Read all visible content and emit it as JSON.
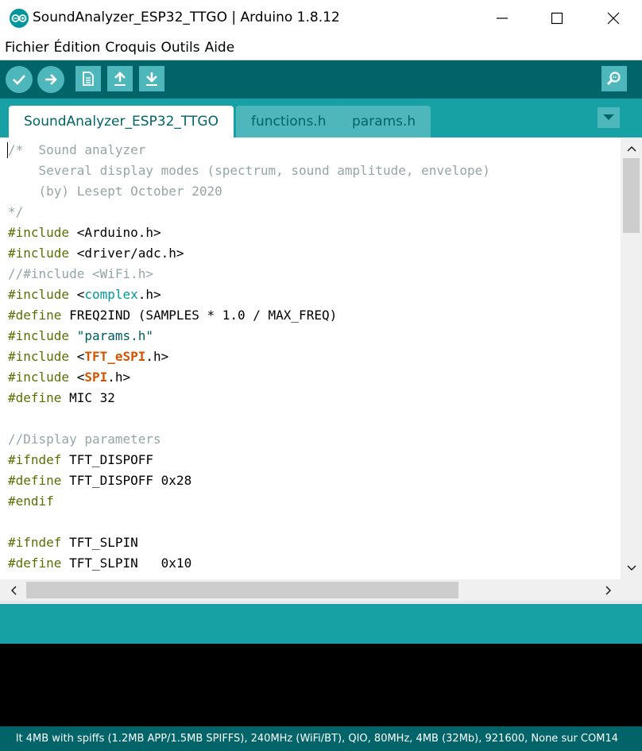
{
  "window": {
    "title": "SoundAnalyzer_ESP32_TTGO | Arduino 1.8.12",
    "logo_icon": "arduino-logo-icon",
    "controls": [
      "minimize-icon",
      "maximize-icon",
      "close-icon"
    ]
  },
  "menu": [
    {
      "label": "Fichier"
    },
    {
      "label": "Édition"
    },
    {
      "label": "Croquis"
    },
    {
      "label": "Outils"
    },
    {
      "label": "Aide"
    }
  ],
  "toolbar": {
    "icons": [
      "verify-check-icon",
      "upload-arrow-icon",
      "new-sketch-icon",
      "open-arrow-up-icon",
      "save-arrow-down-icon",
      "serial-monitor-magnifier-icon"
    ]
  },
  "tabs": [
    {
      "label": "SoundAnalyzer_ESP32_TTGO",
      "active": true
    },
    {
      "label": "functions.h",
      "active": false
    },
    {
      "label": "params.h",
      "active": false
    }
  ],
  "editor": {
    "lines": [
      [
        {
          "t": "/*  Sound analyzer",
          "c": "comment"
        }
      ],
      [
        {
          "t": "    Several display modes (spectrum, sound amplitude, envelope)",
          "c": "comment"
        }
      ],
      [
        {
          "t": "    (by) Lesept October 2020",
          "c": "comment"
        }
      ],
      [
        {
          "t": "*/",
          "c": "comment"
        }
      ],
      [
        {
          "t": "#include",
          "c": "pre"
        },
        {
          "t": " <Arduino.h>",
          "c": ""
        }
      ],
      [
        {
          "t": "#include",
          "c": "pre"
        },
        {
          "t": " <driver/adc.h>",
          "c": ""
        }
      ],
      [
        {
          "t": "//#include <WiFi.h>",
          "c": "comment"
        }
      ],
      [
        {
          "t": "#include",
          "c": "pre"
        },
        {
          "t": " <",
          "c": ""
        },
        {
          "t": "complex",
          "c": "kw"
        },
        {
          "t": ".h>",
          "c": ""
        }
      ],
      [
        {
          "t": "#define",
          "c": "pre"
        },
        {
          "t": " FREQ2IND (SAMPLES * 1.0 / MAX_FREQ)",
          "c": ""
        }
      ],
      [
        {
          "t": "#include",
          "c": "pre"
        },
        {
          "t": " ",
          "c": ""
        },
        {
          "t": "\"params.h\"",
          "c": "str"
        }
      ],
      [
        {
          "t": "#include",
          "c": "pre"
        },
        {
          "t": " <",
          "c": ""
        },
        {
          "t": "TFT_eSPI",
          "c": "lib"
        },
        {
          "t": ".h>",
          "c": ""
        }
      ],
      [
        {
          "t": "#include",
          "c": "pre"
        },
        {
          "t": " <",
          "c": ""
        },
        {
          "t": "SPI",
          "c": "lib"
        },
        {
          "t": ".h>",
          "c": ""
        }
      ],
      [
        {
          "t": "#define",
          "c": "pre"
        },
        {
          "t": " MIC 32",
          "c": ""
        }
      ],
      [
        {
          "t": "",
          "c": ""
        }
      ],
      [
        {
          "t": "//Display parameters",
          "c": "comment"
        }
      ],
      [
        {
          "t": "#ifndef",
          "c": "pre"
        },
        {
          "t": " TFT_DISPOFF",
          "c": ""
        }
      ],
      [
        {
          "t": "#define",
          "c": "pre"
        },
        {
          "t": " TFT_DISPOFF 0x28",
          "c": ""
        }
      ],
      [
        {
          "t": "#endif",
          "c": "pre"
        }
      ],
      [
        {
          "t": "",
          "c": ""
        }
      ],
      [
        {
          "t": "#ifndef",
          "c": "pre"
        },
        {
          "t": " TFT_SLPIN",
          "c": ""
        }
      ],
      [
        {
          "t": "#define",
          "c": "pre"
        },
        {
          "t": " TFT_SLPIN   0x10",
          "c": ""
        }
      ]
    ]
  },
  "status": {
    "board_info": "lt 4MB with spiffs (1.2MB APP/1.5MB SPIFFS), 240MHz (WiFi/BT), QIO, 80MHz, 4MB (32Mb), 921600, None sur COM14"
  }
}
